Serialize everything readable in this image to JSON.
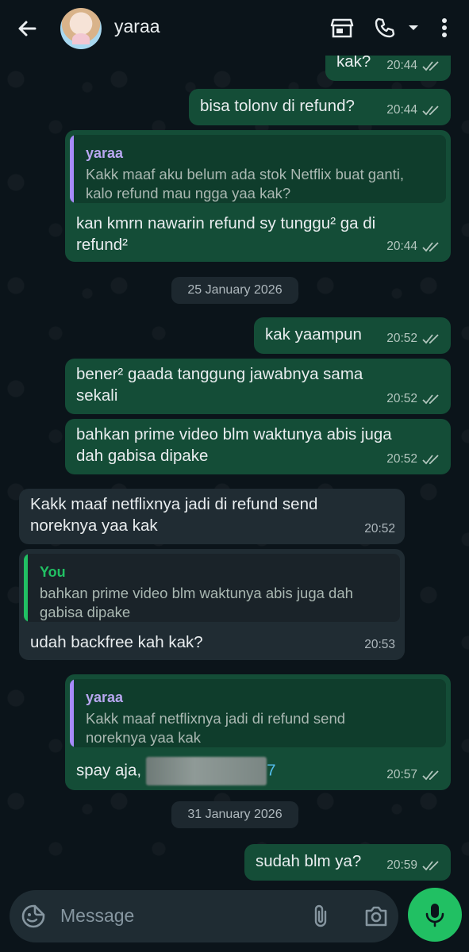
{
  "header": {
    "contact_name": "yaraa",
    "icons": [
      "back-arrow-icon",
      "avatar",
      "shop-icon",
      "phone-icon",
      "dropdown-icon",
      "more-vert-icon"
    ]
  },
  "messages": [
    {
      "dir": "out",
      "text": "kak?",
      "time": "20:44",
      "ticks": "double-check"
    },
    {
      "dir": "out",
      "text": "bisa tolonv di refund?",
      "time": "20:44",
      "ticks": "double-check"
    },
    {
      "dir": "out",
      "quote_author": "yaraa",
      "quote_text": "Kakk maaf aku belum ada stok Netflix buat ganti,\nkalo refund mau ngga yaa kak?",
      "text": "kan kmrn nawarin refund sy tunggu² ga di\nrefund²",
      "time": "20:44",
      "ticks": "double-check"
    },
    {
      "dir": "out",
      "text": "kak yaampun",
      "time": "20:52",
      "ticks": "double-check"
    },
    {
      "dir": "out",
      "text": "bener² gaada tanggung jawabnya sama\nsekali",
      "time": "20:52",
      "ticks": "double-check"
    },
    {
      "dir": "out",
      "text": "bahkan prime video blm waktunya abis juga\ndah gabisa dipake",
      "time": "20:52",
      "ticks": "double-check"
    },
    {
      "dir": "in",
      "text": "Kakk maaf netflixnya jadi di refund send\nnoreknya yaa kak",
      "time": "20:52"
    },
    {
      "dir": "in",
      "quote_author": "You",
      "quote_text": "bahkan prime video blm waktunya abis juga dah\ngabisa dipake",
      "text": "udah backfree kah kak?",
      "time": "20:53"
    },
    {
      "dir": "out",
      "quote_author": "yaraa",
      "quote_text": "Kakk maaf netflixnya jadi di refund send\nnoreknya yaa kak",
      "text": "spay aja,",
      "redacted_suffix": "7",
      "time": "20:57",
      "ticks": "double-check"
    },
    {
      "dir": "out",
      "text": "sudah blm ya?",
      "time": "20:59",
      "ticks": "double-check"
    }
  ],
  "date_separators": [
    "25 January 2026",
    "31 January 2026"
  ],
  "composer": {
    "placeholder": "Message",
    "icons": [
      "emoji-sticker-icon",
      "attach-icon",
      "camera-icon",
      "mic-icon"
    ]
  },
  "colors": {
    "background": "#0b141a",
    "outgoing_bubble": "#144d37",
    "incoming_bubble": "#202c33",
    "quote_bar_yaraa": "#a78bfa",
    "quote_bar_you": "#21c063",
    "quote_name_yaraa": "#b8a7f0",
    "quote_name_you": "#21c063",
    "mic_button": "#21c063"
  }
}
